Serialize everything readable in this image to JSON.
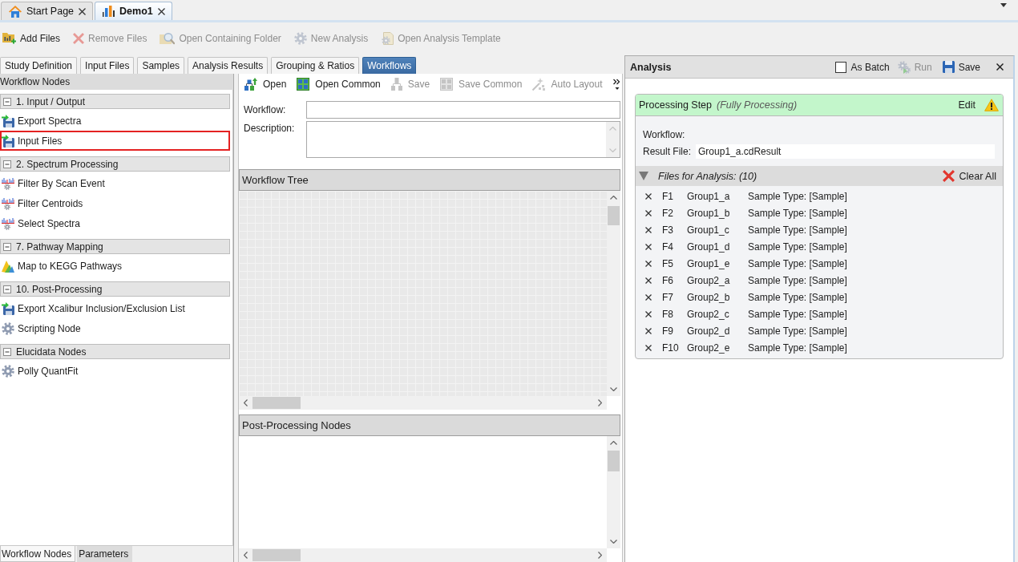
{
  "document_tabs": [
    {
      "label": "Start Page",
      "kind": "home",
      "selected": false
    },
    {
      "label": "Demo1",
      "kind": "chart",
      "selected": true
    }
  ],
  "toolbar": [
    {
      "label": "Add Files",
      "kind": "add-files",
      "disabled": false
    },
    {
      "label": "Remove Files",
      "kind": "remove",
      "disabled": true
    },
    {
      "label": "Open Containing Folder",
      "kind": "folder-search",
      "disabled": true
    },
    {
      "label": "New Analysis",
      "kind": "gear",
      "disabled": true
    },
    {
      "label": "Open Analysis Template",
      "kind": "template",
      "disabled": true
    }
  ],
  "tabs": [
    {
      "label": "Study Definition",
      "selected": false
    },
    {
      "label": "Input Files",
      "selected": false
    },
    {
      "label": "Samples",
      "selected": false
    },
    {
      "label": "Analysis Results",
      "selected": false
    },
    {
      "label": "Grouping & Ratios",
      "selected": false
    },
    {
      "label": "Workflows",
      "selected": true
    }
  ],
  "workflow_nodes": {
    "title": "Workflow Nodes",
    "groups": [
      {
        "label": "1. Input / Output",
        "expanded": true,
        "children": [
          {
            "label": "Export Spectra",
            "kind": "export",
            "selected": false
          },
          {
            "label": "Input Files",
            "kind": "export",
            "selected": true
          }
        ]
      },
      {
        "label": "2. Spectrum Processing",
        "expanded": true,
        "children": [
          {
            "label": "Filter By Scan Event",
            "kind": "spectrum",
            "selected": false
          },
          {
            "label": "Filter Centroids",
            "kind": "spectrum",
            "selected": false
          },
          {
            "label": "Select Spectra",
            "kind": "spectrum",
            "selected": false
          }
        ]
      },
      {
        "label": "7. Pathway Mapping",
        "expanded": true,
        "children": [
          {
            "label": "Map to KEGG Pathways",
            "kind": "pathway",
            "selected": false
          }
        ]
      },
      {
        "label": "10. Post-Processing",
        "expanded": true,
        "children": [
          {
            "label": "Export Xcalibur Inclusion/Exclusion List",
            "kind": "export",
            "selected": false
          },
          {
            "label": "Scripting Node",
            "kind": "gear",
            "selected": false
          }
        ]
      },
      {
        "label": "Elucidata Nodes",
        "expanded": true,
        "children": [
          {
            "label": "Polly QuantFit",
            "kind": "gear",
            "selected": false
          }
        ]
      }
    ]
  },
  "panel_tabs": [
    {
      "label": "Workflow Nodes",
      "selected": true
    },
    {
      "label": "Parameters",
      "selected": false
    }
  ],
  "workflow_toolbar": [
    {
      "label": "Open",
      "kind": "open",
      "disabled": false
    },
    {
      "label": "Open Common",
      "kind": "open-common",
      "disabled": false
    },
    {
      "label": "Save",
      "kind": "save",
      "disabled": true
    },
    {
      "label": "Save Common",
      "kind": "save-common",
      "disabled": true
    },
    {
      "label": "Auto Layout",
      "kind": "auto-layout",
      "disabled": true
    }
  ],
  "workflow_form": {
    "workflow_label": "Workflow:",
    "description_label": "Description:"
  },
  "workflow_tree": {
    "title": "Workflow Tree"
  },
  "post_processing_nodes": {
    "title": "Post-Processing Nodes"
  },
  "analysis": {
    "title": "Analysis",
    "as_batch": {
      "label": "As Batch",
      "checked": false
    },
    "run": {
      "label": "Run",
      "disabled": true
    },
    "save": {
      "label": "Save"
    },
    "processing_step": {
      "title": "Processing Step",
      "status": "(Fully Processing)",
      "edit": "Edit",
      "workflow_label": "Workflow:",
      "result_file_label": "Result File:",
      "result_file": "Group1_a.cdResult"
    },
    "files": {
      "title": "Files for Analysis: (10)",
      "expanded": true,
      "clear_all": "Clear All",
      "rows": [
        {
          "number": "F1",
          "name": "Group1_a",
          "sample_type": "Sample Type: [Sample]"
        },
        {
          "number": "F2",
          "name": "Group1_b",
          "sample_type": "Sample Type: [Sample]"
        },
        {
          "number": "F3",
          "name": "Group1_c",
          "sample_type": "Sample Type: [Sample]"
        },
        {
          "number": "F4",
          "name": "Group1_d",
          "sample_type": "Sample Type: [Sample]"
        },
        {
          "number": "F5",
          "name": "Group1_e",
          "sample_type": "Sample Type: [Sample]"
        },
        {
          "number": "F6",
          "name": "Group2_a",
          "sample_type": "Sample Type: [Sample]"
        },
        {
          "number": "F7",
          "name": "Group2_b",
          "sample_type": "Sample Type: [Sample]"
        },
        {
          "number": "F8",
          "name": "Group2_c",
          "sample_type": "Sample Type: [Sample]"
        },
        {
          "number": "F9",
          "name": "Group2_d",
          "sample_type": "Sample Type: [Sample]"
        },
        {
          "number": "F10",
          "name": "Group2_e",
          "sample_type": "Sample Type: [Sample]"
        }
      ]
    }
  }
}
